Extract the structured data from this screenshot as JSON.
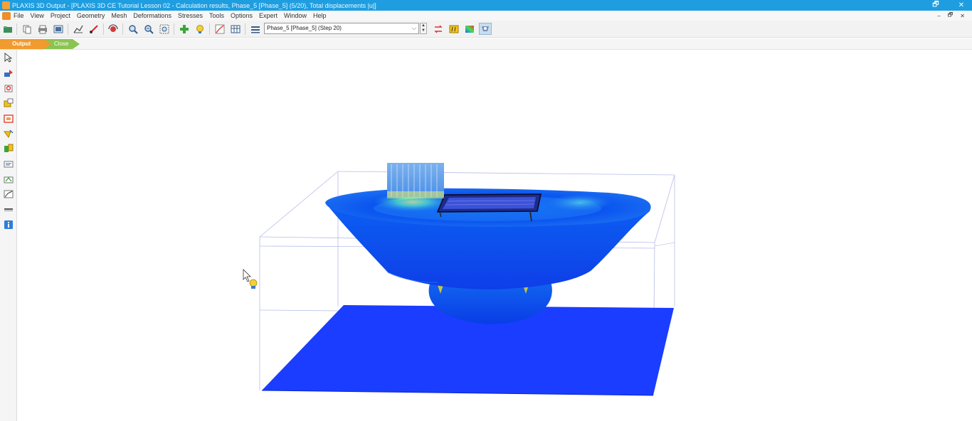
{
  "window": {
    "title": "PLAXIS 3D Output - [PLAXIS 3D CE Tutorial Lesson 02 - Calculation results, Phase_5 [Phase_5] (5/20), Total displacements |u|]",
    "controls": [
      "🗗",
      "✕"
    ]
  },
  "menubar": {
    "items": [
      "File",
      "View",
      "Project",
      "Geometry",
      "Mesh",
      "Deformations",
      "Stresses",
      "Tools",
      "Options",
      "Expert",
      "Window",
      "Help"
    ],
    "mdi_controls": [
      "–",
      "🗗",
      "✕"
    ]
  },
  "toolbar": {
    "phase_select_value": "Phase_5 [Phase_5] (Step 20)",
    "spin_up": "▲",
    "spin_down": "▼",
    "dropdown_arrow": "⌵"
  },
  "tabs": {
    "output": "Output",
    "close": "Close"
  },
  "icons": {
    "toolbar": [
      "open-project-icon",
      "copy-icon",
      "print-icon",
      "export-icon",
      "zoom-out-icon",
      "draw-scanline-icon",
      "rotate-icon",
      "zoom-in-icon",
      "zoom-out-icon",
      "zoom-window-icon",
      "add-icon",
      "hint-icon",
      "curves-manager-icon",
      "table-icon",
      "phase-list-icon",
      "swap-icon",
      "legend-icon",
      "contour-icon",
      "view-mode-icon"
    ],
    "side": [
      "select-icon",
      "move-icon",
      "selection-icon",
      "partial-geometry-icon",
      "hide-icon",
      "measure-icon",
      "cross-section-icon",
      "annotations-icon",
      "spatial-icon",
      "surface-icon",
      "line-icon",
      "info-icon"
    ]
  },
  "colors": {
    "titlebar": "#1e9ee0",
    "output_tab": "#f19a2e",
    "close_tab": "#8ac451",
    "soil_blue": "#1a3dff",
    "excavation_blue": "#0f5cf0"
  }
}
